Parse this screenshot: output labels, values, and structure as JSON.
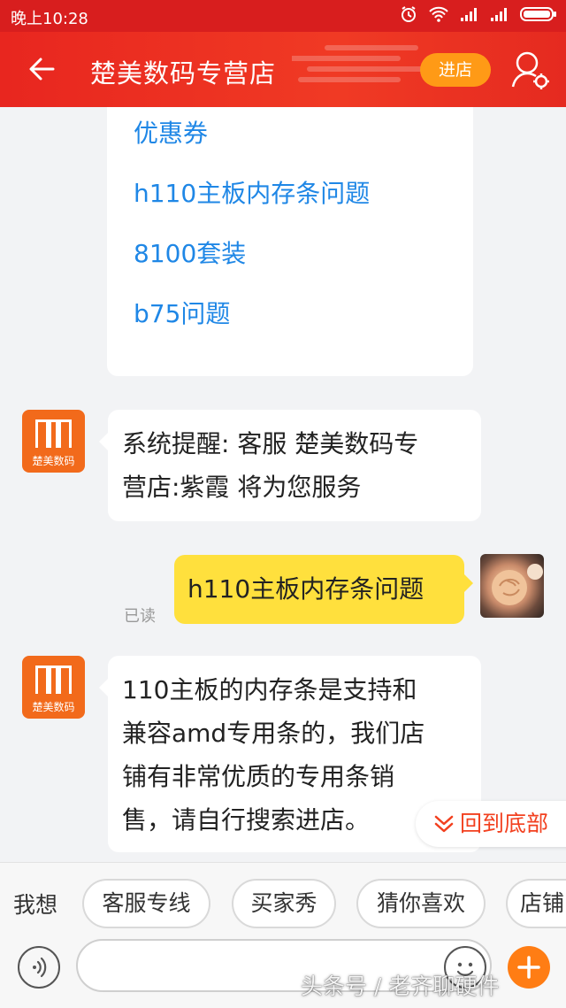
{
  "status_bar": {
    "time": "晚上10:28"
  },
  "header": {
    "title": "楚美数码专营店",
    "enter_label": "进店"
  },
  "quick_links": [
    "优惠券",
    "h110主板内存条问题",
    "8100套装",
    "b75问题"
  ],
  "messages": {
    "system_line1": "系统提醒: 客服 楚美数码专",
    "system_line2": "营店:紫霞 将为您服务",
    "user_text": "h110主板内存条问题",
    "read_status": "已读",
    "reply_line1": "110主板的内存条是支持和",
    "reply_line2": "兼容amd专用条的，我们店",
    "reply_line3": "铺有非常优质的专用条销",
    "reply_line4": "售，请自行搜索进店。",
    "shop_avatar_brand": "楚美数码"
  },
  "back_to_bottom": "回到底部",
  "bottom_bar": {
    "wish_label": "我想",
    "chips": [
      "客服专线",
      "买家秀",
      "猜你喜欢",
      "店铺"
    ],
    "input_placeholder": ""
  },
  "watermark": "头条号 / 老齐聊硬件",
  "colors": {
    "header_red": "#e8261f",
    "enter_orange": "#ff9a16",
    "link_blue": "#1f87e6",
    "user_bubble": "#ffe03d",
    "shop_orange": "#f26a1b"
  }
}
